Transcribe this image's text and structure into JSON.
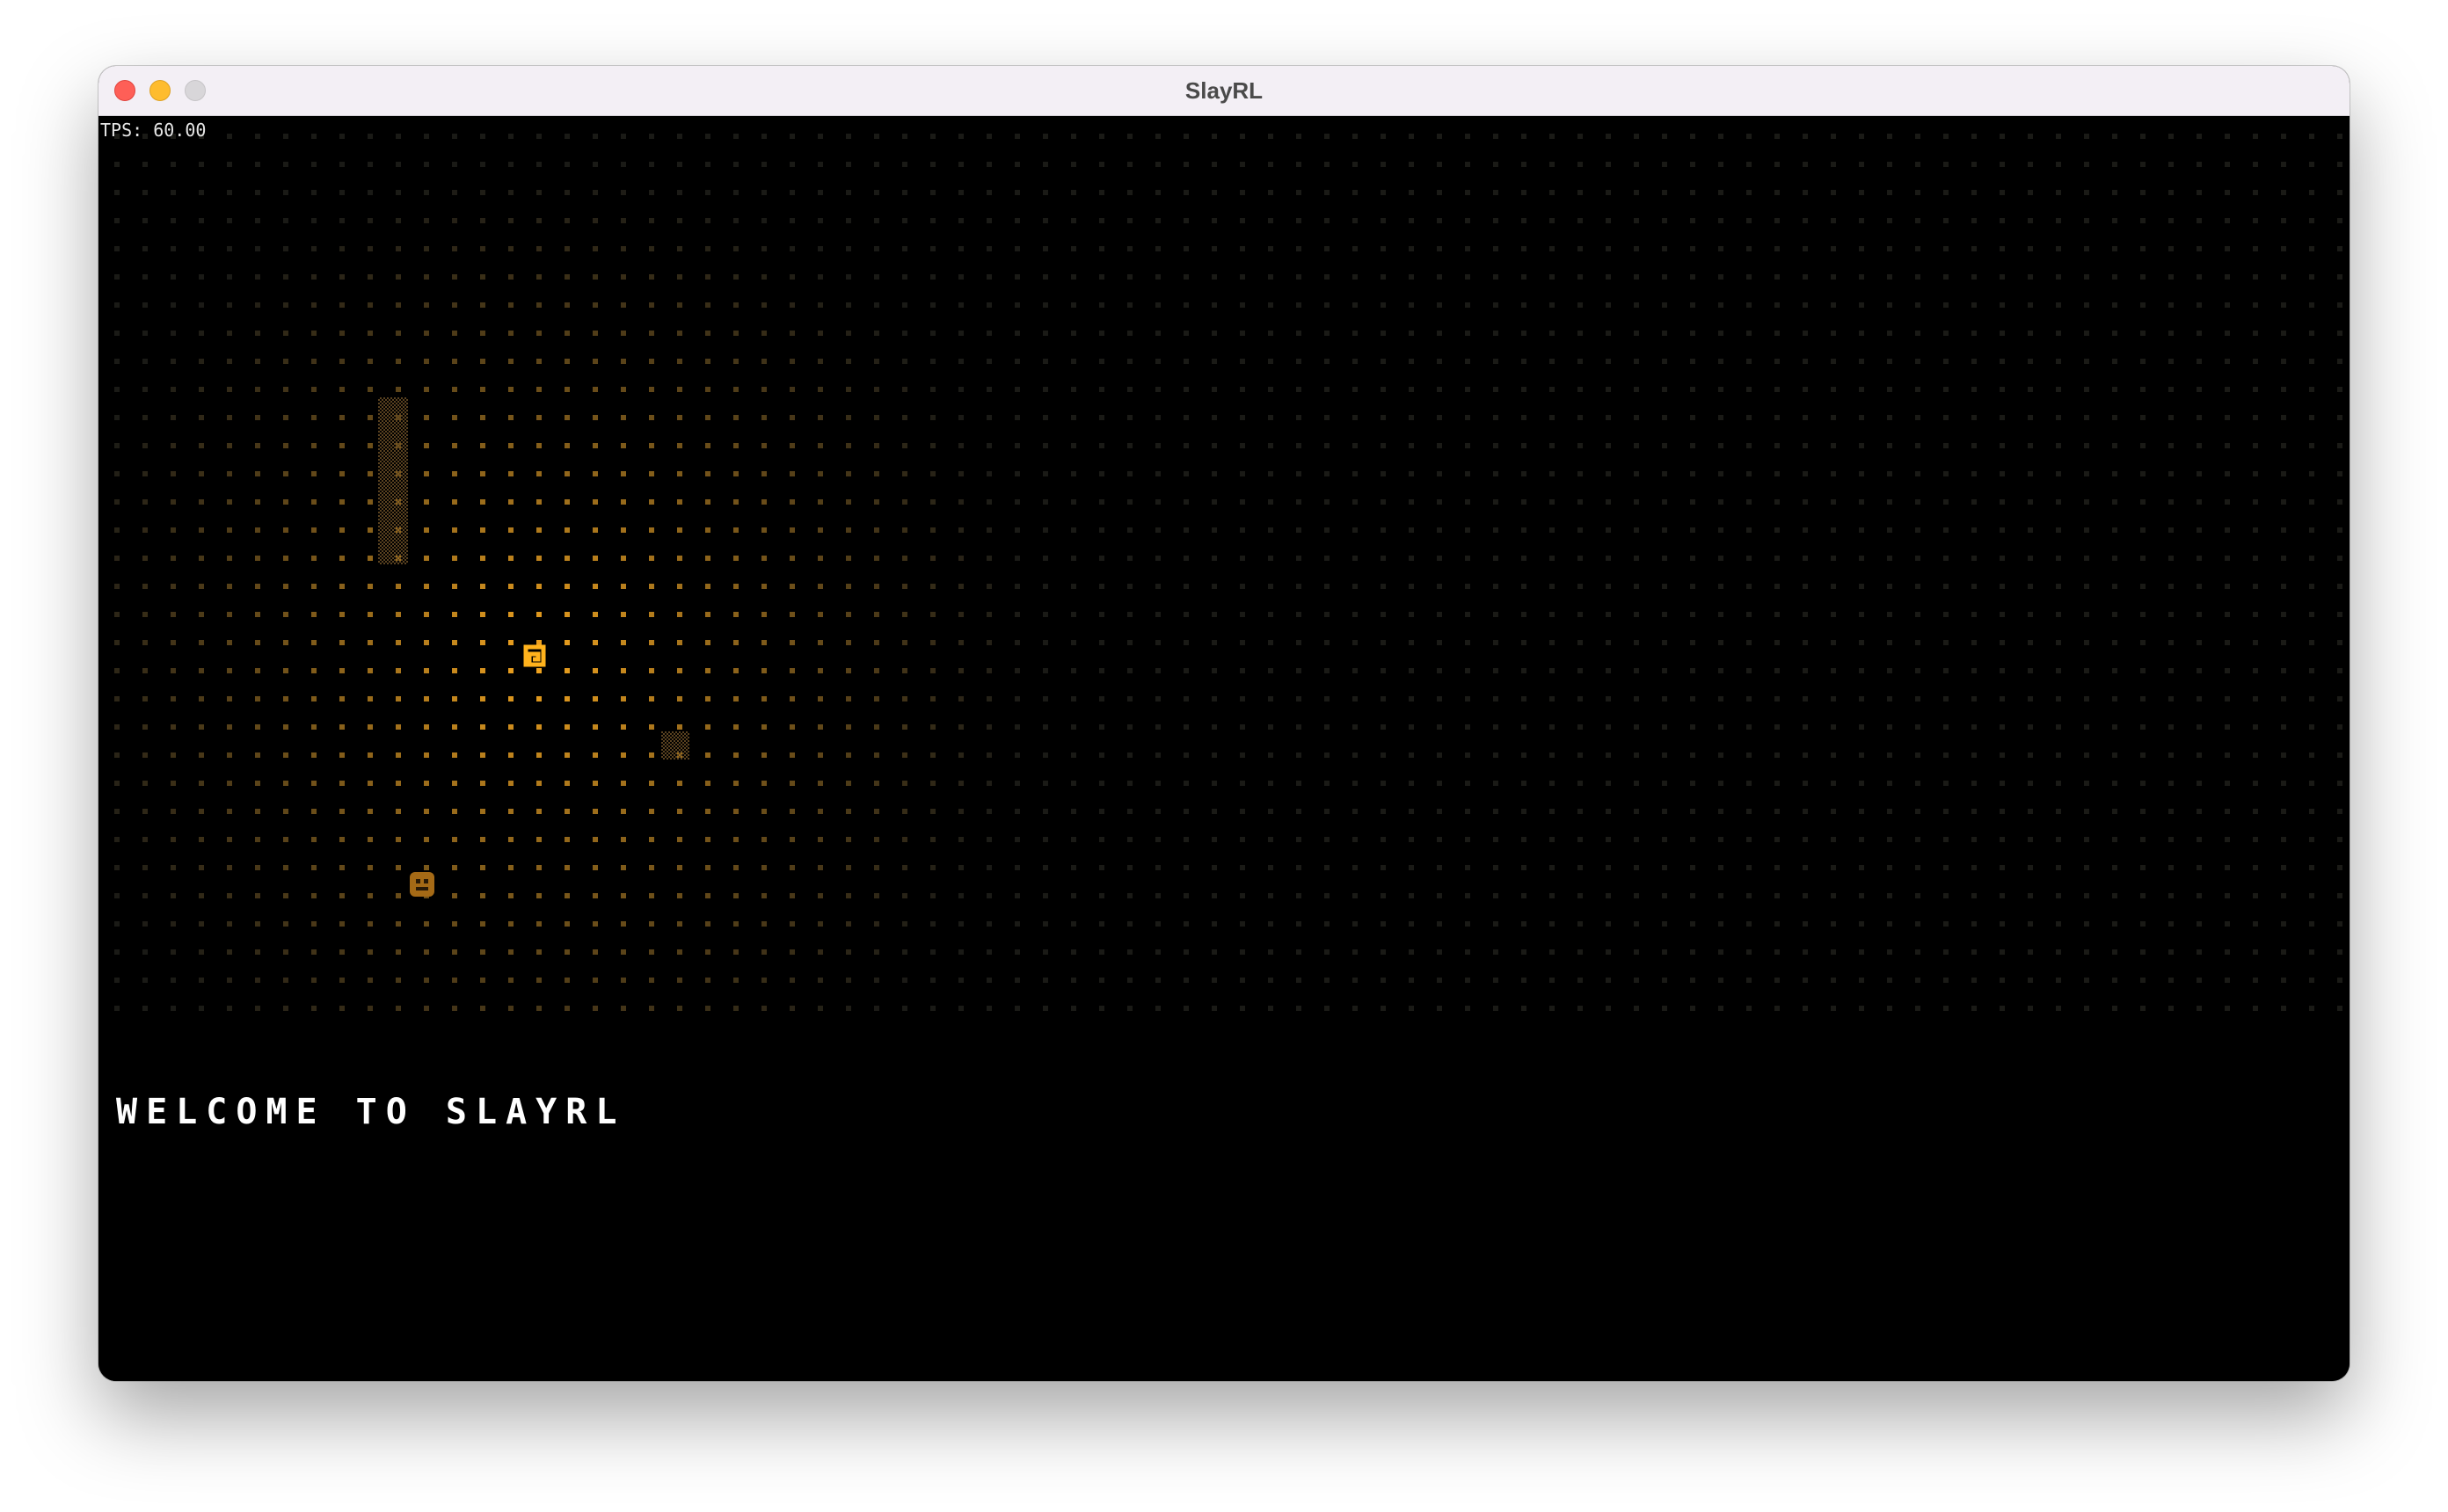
{
  "window": {
    "title": "SlayRL"
  },
  "hud": {
    "tps_label": "TPS: 60.00"
  },
  "log": {
    "message": "WELCOME TO SLAYRL"
  },
  "map": {
    "floor_glyph": "·",
    "player_glyph": "@",
    "monster_glyph": "☻",
    "light_color": "#f5a623",
    "background_color": "#000000"
  }
}
